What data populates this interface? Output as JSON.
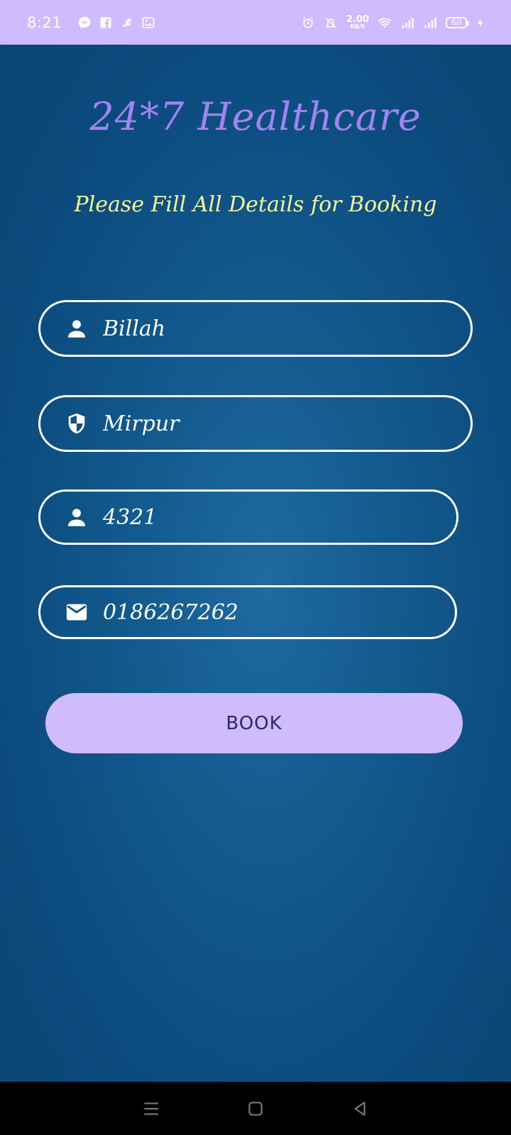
{
  "status_bar": {
    "time": "8:21",
    "net_speed_value": "2.00",
    "net_speed_unit": "KB/S",
    "battery_level": "60",
    "left_icons": [
      "messenger-icon",
      "facebook-icon",
      "airtel-icon",
      "gallery-icon"
    ],
    "right_icons": [
      "alarm-icon",
      "vibrate-icon",
      "wifi-icon",
      "signal-icon",
      "signal-icon",
      "battery-icon",
      "charging-icon"
    ]
  },
  "header": {
    "title": "24*7 Healthcare",
    "subtitle": "Please Fill All Details for Booking"
  },
  "form": {
    "name_value": "Billah",
    "address_value": "Mirpur",
    "id_value": "4321",
    "phone_value": "0186267262",
    "book_label": "BOOK"
  },
  "colors": {
    "accent": "#d1bbff",
    "title": "#a084f2",
    "subtitle": "#f3f59a",
    "background": "#0d4a7c"
  }
}
